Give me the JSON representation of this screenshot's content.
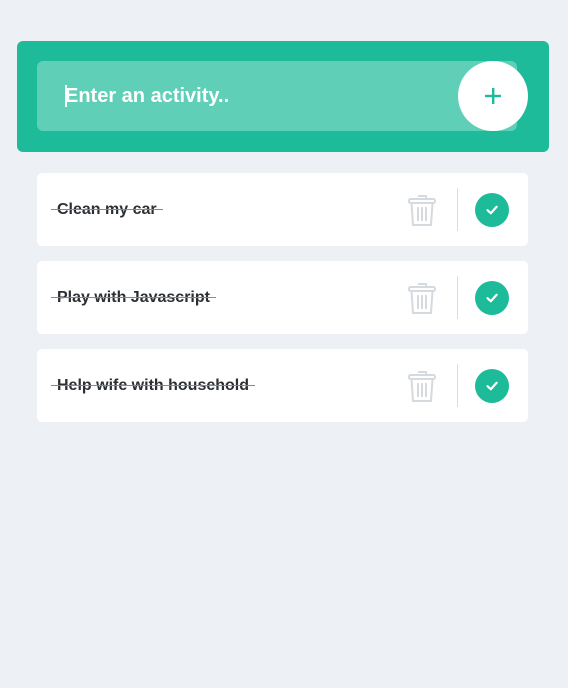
{
  "input": {
    "placeholder": "Enter an activity..",
    "value": ""
  },
  "add_button": {
    "icon": "plus-icon"
  },
  "todos": [
    {
      "text": "Clean my car",
      "completed": true
    },
    {
      "text": "Play with Javascript",
      "completed": true
    },
    {
      "text": "Help wife with household",
      "completed": true
    }
  ],
  "icons": {
    "delete": "trash-icon",
    "complete": "check-icon"
  },
  "colors": {
    "accent": "#1dbb99",
    "input_bg": "#5fd0b7",
    "background": "#edf1f6",
    "card": "#ffffff",
    "trash": "#d5dadf"
  }
}
